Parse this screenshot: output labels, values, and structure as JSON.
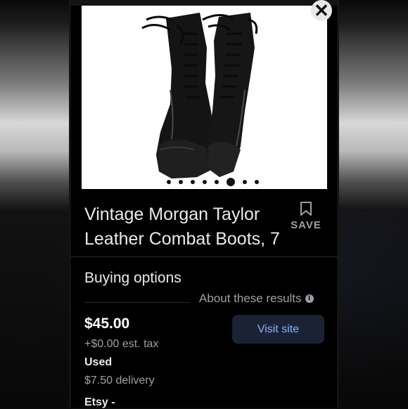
{
  "product": {
    "title_line1": "Vintage Morgan Taylor",
    "title_line2": "Leather Combat Boots, 7",
    "save_label": "SAVE",
    "image_icon": "boots-photo",
    "carousel": {
      "count": 8,
      "active_index": 5
    }
  },
  "buying": {
    "heading": "Buying options",
    "about_label": "About these results",
    "offer": {
      "price": "$45.00",
      "tax": "+$0.00 est. tax",
      "condition": "Used",
      "delivery": "$7.50 delivery",
      "seller": "Etsy -",
      "visit_label": "Visit site"
    }
  },
  "colors": {
    "background": "#000000",
    "text_primary": "#e8eaed",
    "text_secondary": "#9aa0a6",
    "link": "#8ab4f8",
    "button_bg": "#1a2234"
  }
}
